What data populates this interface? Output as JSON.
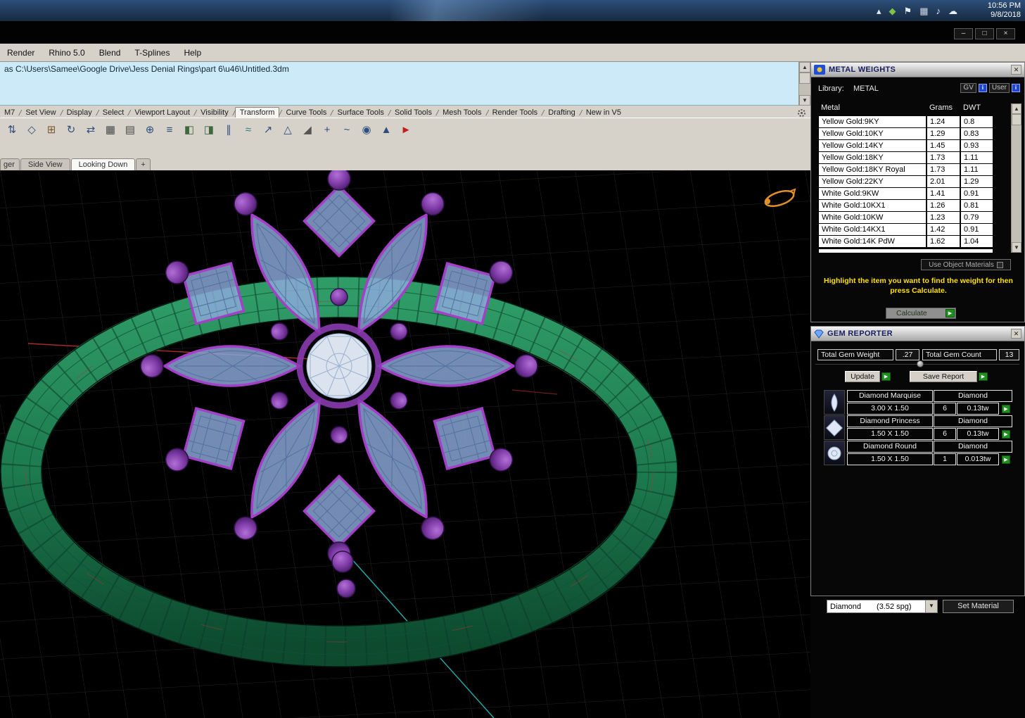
{
  "taskbar": {
    "time": "10:56 PM",
    "date": "9/8/2018",
    "tray_icons": [
      {
        "name": "chevron-up-icon",
        "glyph": "▴",
        "color": "#dfe8f2"
      },
      {
        "name": "antivirus-icon",
        "glyph": "◆",
        "color": "#7ec24a"
      },
      {
        "name": "action-center-flag-icon",
        "glyph": "⚑",
        "color": "#e8eef5"
      },
      {
        "name": "network-icon",
        "glyph": "▦",
        "color": "#cdd8e4"
      },
      {
        "name": "volume-icon",
        "glyph": "♪",
        "color": "#e8eef5"
      },
      {
        "name": "cloud-icon",
        "glyph": "☁",
        "color": "#e8eef5"
      }
    ]
  },
  "window_controls": {
    "minimize": "–",
    "restore": "□",
    "close": "×"
  },
  "menu_bar": {
    "items": [
      "Render",
      "Rhino 5.0",
      "Blend",
      "T-Splines",
      "Help"
    ]
  },
  "command_area": {
    "history_line": "as C:\\Users\\Samee\\Google Drive\\Jess Denial Rings\\part 6\\u46\\Untitled.3dm"
  },
  "ribbon_tabs": {
    "items": [
      "M7",
      "Set View",
      "Display",
      "Select",
      "Viewport Layout",
      "Visibility",
      "Transform",
      "Curve Tools",
      "Surface Tools",
      "Solid Tools",
      "Mesh Tools",
      "Render Tools",
      "Drafting",
      "New in V5"
    ],
    "active": "Transform"
  },
  "toolbar": {
    "icons": [
      {
        "g": "⇅",
        "c": "#2e4f7d"
      },
      {
        "g": "◇",
        "c": "#2e4f7d"
      },
      {
        "g": "⊞",
        "c": "#7a5a2a"
      },
      {
        "g": "↻",
        "c": "#2e4f7d"
      },
      {
        "g": "⇄",
        "c": "#2e4f7d"
      },
      {
        "g": "▦",
        "c": "#4a4a4a"
      },
      {
        "g": "▤",
        "c": "#4a4a4a"
      },
      {
        "g": "⊕",
        "c": "#2e4f7d"
      },
      {
        "g": "≡",
        "c": "#2e4f7d"
      },
      {
        "g": "◧",
        "c": "#3d6a3d"
      },
      {
        "g": "◨",
        "c": "#3d6a3d"
      },
      {
        "g": "∥",
        "c": "#2e4f7d"
      },
      {
        "g": "≈",
        "c": "#2e7d7d"
      },
      {
        "g": "↗",
        "c": "#2e4f7d"
      },
      {
        "g": "△",
        "c": "#2e4f7d"
      },
      {
        "g": "◢",
        "c": "#555555"
      },
      {
        "g": "+",
        "c": "#2e4f7d"
      },
      {
        "g": "~",
        "c": "#2e4f7d"
      },
      {
        "g": "◉",
        "c": "#2e4f7d"
      },
      {
        "g": "▲",
        "c": "#2e4f7d"
      },
      {
        "g": "►",
        "c": "#c22020"
      }
    ]
  },
  "viewport_tabs": {
    "items": [
      "ger",
      "Side View",
      "Looking Down",
      "+"
    ],
    "active": "Looking Down"
  },
  "metal_weights": {
    "title": "METAL WEIGHTS",
    "library_label": "Library:",
    "library_value": "METAL",
    "gv_label": "GV",
    "user_label": "User",
    "columns": [
      "Metal",
      "Grams",
      "DWT"
    ],
    "rows": [
      {
        "metal": "Yellow Gold:9KY",
        "grams": "1.24",
        "dwt": "0.8"
      },
      {
        "metal": "Yellow Gold:10KY",
        "grams": "1.29",
        "dwt": "0.83"
      },
      {
        "metal": "Yellow Gold:14KY",
        "grams": "1.45",
        "dwt": "0.93"
      },
      {
        "metal": "Yellow Gold:18KY",
        "grams": "1.73",
        "dwt": "1.11"
      },
      {
        "metal": "Yellow Gold:18KY Royal",
        "grams": "1.73",
        "dwt": "1.11"
      },
      {
        "metal": "Yellow Gold:22KY",
        "grams": "2.01",
        "dwt": "1.29"
      },
      {
        "metal": "White Gold:9KW",
        "grams": "1.41",
        "dwt": "0.91"
      },
      {
        "metal": "White Gold:10KX1",
        "grams": "1.26",
        "dwt": "0.81"
      },
      {
        "metal": "White Gold:10KW",
        "grams": "1.23",
        "dwt": "0.79"
      },
      {
        "metal": "White Gold:14KX1",
        "grams": "1.42",
        "dwt": "0.91"
      },
      {
        "metal": "White Gold:14K PdW",
        "grams": "1.62",
        "dwt": "1.04"
      }
    ],
    "use_object_materials": "Use Object Materials",
    "hint": "Highlight the item you want to find the weight for then press Calculate.",
    "calculate_label": "Calculate"
  },
  "gem_reporter": {
    "title": "GEM REPORTER",
    "total_weight_label": "Total Gem Weight",
    "total_weight": ".27",
    "total_count_label": "Total Gem Count",
    "total_count": "13",
    "update_label": "Update",
    "save_report_label": "Save Report",
    "gems": [
      {
        "name": "Diamond Marquise",
        "material": "Diamond",
        "size": "3.00 X 1.50",
        "count": "6",
        "weight": "0.13tw",
        "icon": "marquise"
      },
      {
        "name": "Diamond Princess",
        "material": "Diamond",
        "size": "1.50 X 1.50",
        "count": "6",
        "weight": "0.13tw",
        "icon": "princess"
      },
      {
        "name": "Diamond Round",
        "material": "Diamond",
        "size": "1.50 X 1.50",
        "count": "1",
        "weight": "0.013tw",
        "icon": "round"
      }
    ],
    "material_name": "Diamond",
    "material_spg": "(3.52 spg)",
    "set_material_label": "Set Material"
  }
}
